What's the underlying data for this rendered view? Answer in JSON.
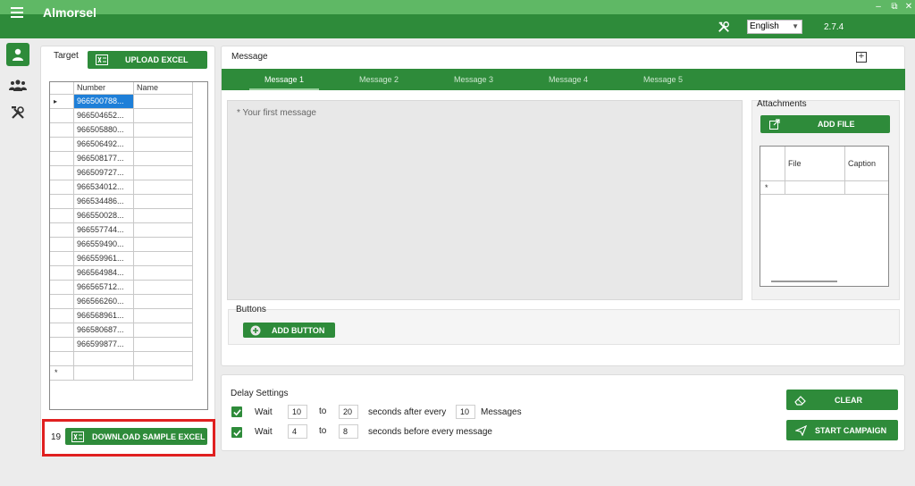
{
  "app": {
    "title": "Almorsel",
    "version": "2.7.4",
    "language": "English"
  },
  "window": {
    "minimize": "‒",
    "restore": "⧉",
    "close": "✕"
  },
  "sidebar": {
    "items": [
      "person-icon",
      "group-icon",
      "tools-icon"
    ]
  },
  "target": {
    "label": "Target",
    "upload_label": "UPLOAD EXCEL",
    "columns": [
      "Number",
      "Name"
    ],
    "rows": [
      "966500788...",
      "966504652...",
      "966505880...",
      "966506492...",
      "966508177...",
      "966509727...",
      "966534012...",
      "966534486...",
      "966550028...",
      "966557744...",
      "966559490...",
      "966559961...",
      "966564984...",
      "966565712...",
      "966566260...",
      "966568961...",
      "966580687...",
      "966599877..."
    ],
    "count": "19",
    "download_label": "DOWNLOAD SAMPLE EXCEL",
    "new_row_marker": "*",
    "current_row_marker": "▸"
  },
  "message": {
    "label": "Message",
    "add_tab": "+",
    "tabs": [
      "Message 1",
      "Message 2",
      "Message 3",
      "Message 4",
      "Message 5"
    ],
    "placeholder": "* Your first message",
    "attachments_label": "Attachments",
    "add_file_label": "ADD FILE",
    "file_columns": [
      "File",
      "Caption"
    ],
    "new_row_marker": "*",
    "buttons_label": "Buttons",
    "add_button_label": "ADD BUTTON"
  },
  "delay": {
    "label": "Delay Settings",
    "row1": {
      "wait": "Wait",
      "from": "10",
      "to_label": "to",
      "to": "20",
      "text": "seconds after every",
      "count": "10",
      "unit": "Messages"
    },
    "row2": {
      "wait": "Wait",
      "from": "4",
      "to_label": "to",
      "to": "8",
      "text": "seconds before every message"
    }
  },
  "actions": {
    "clear_label": "CLEAR",
    "start_label": "START CAMPAIGN"
  },
  "colors": {
    "accent": "#2e8b3a",
    "titlebar": "#5fb865",
    "highlight": "#e02020",
    "selection": "#1e7fd8"
  }
}
